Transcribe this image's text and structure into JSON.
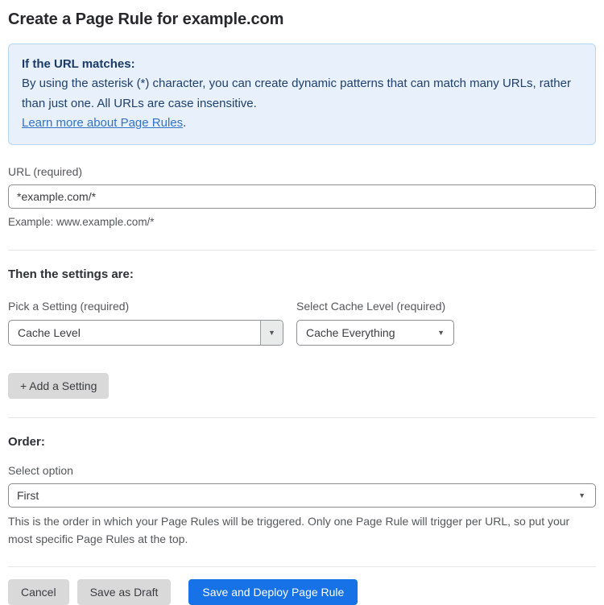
{
  "page": {
    "title": "Create a Page Rule for example.com"
  },
  "info_box": {
    "heading": "If the URL matches:",
    "body": "By using the asterisk (*) character, you can create dynamic patterns that can match many URLs, rather than just one. All URLs are case insensitive.",
    "link_label": "Learn more about Page Rules",
    "link_suffix": "."
  },
  "url_field": {
    "label": "URL (required)",
    "value": "*example.com/*",
    "hint": "Example: www.example.com/*"
  },
  "settings": {
    "heading": "Then the settings are:",
    "pick_setting_label": "Pick a Setting (required)",
    "pick_setting_value": "Cache Level",
    "cache_level_label": "Select Cache Level (required)",
    "cache_level_value": "Cache Everything",
    "add_setting_label": "+ Add a Setting"
  },
  "order": {
    "heading": "Order:",
    "label": "Select option",
    "value": "First",
    "hint": "This is the order in which your Page Rules will be triggered. Only one Page Rule will trigger per URL, so put your most specific Page Rules at the top."
  },
  "actions": {
    "cancel_label": "Cancel",
    "save_draft_label": "Save as Draft",
    "save_deploy_label": "Save and Deploy Page Rule"
  },
  "icons": {
    "caret_down_glyph": "▼"
  },
  "colors": {
    "info_box_bg": "#e8f1fb",
    "info_box_border": "#b7d4f0",
    "info_text": "#20406d",
    "link": "#3273c8",
    "primary_button": "#1672e6",
    "gray_button": "#d9d9d9"
  }
}
